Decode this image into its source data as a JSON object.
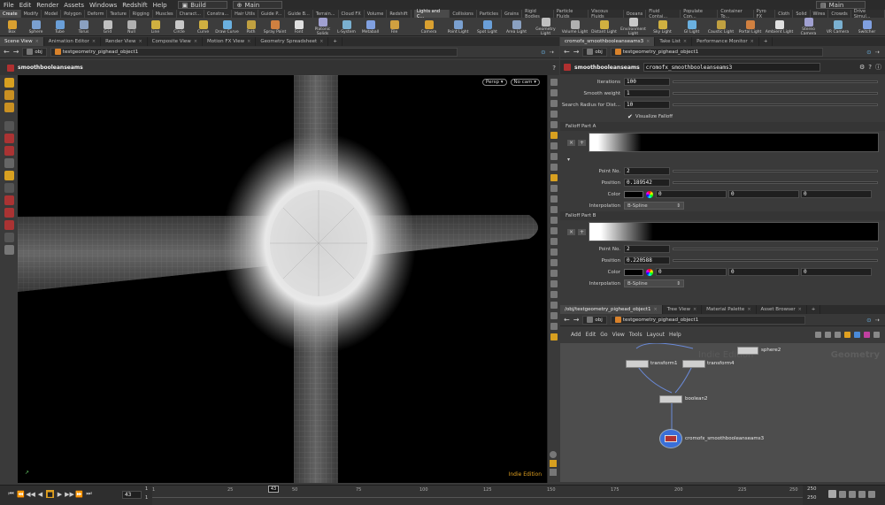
{
  "menubar": {
    "items": [
      "File",
      "Edit",
      "Render",
      "Assets",
      "Windows",
      "Redshift",
      "Help"
    ],
    "desktop": "Build",
    "scene": "Main",
    "right_context": "Main"
  },
  "shelf": {
    "tabs_left": [
      "Create",
      "Modify",
      "Model",
      "Polygon",
      "Deform",
      "Texture",
      "Rigging",
      "Muscles",
      "Charact...",
      "Constra...",
      "Hair Utils",
      "Guide P...",
      "Guide B...",
      "Terrain...",
      "Cloud FX",
      "Volume",
      "Redshift"
    ],
    "tabs_right": [
      "Lights and C...",
      "Collisions",
      "Particles",
      "Grains",
      "Rigid Bodies",
      "Particle Fluids",
      "Viscous Fluids",
      "Oceans",
      "Fluid Contai...",
      "Populate Con...",
      "Container To...",
      "Pyro FX",
      "Cloth",
      "Solid",
      "Wires",
      "Crowds",
      "Drive Simul..."
    ],
    "tools_left": [
      "Box",
      "Sphere",
      "Tube",
      "Torus",
      "Grid",
      "Null",
      "Line",
      "Circle",
      "Curve",
      "Draw Curve",
      "Path",
      "Spray Paint",
      "Font",
      "Platonic Solids",
      "L-System",
      "Metaball",
      "File"
    ],
    "tools_right": [
      "Camera",
      "Point Light",
      "Spot Light",
      "Area Light",
      "Geometry Light",
      "Volume Light",
      "Distant Light",
      "Environment Light",
      "Sky Light",
      "GI Light",
      "Caustic Light",
      "Portal Light",
      "Ambient Light",
      "Stereo Camera",
      "VR Camera",
      "Switcher"
    ]
  },
  "left_pane": {
    "tabs": [
      "Scene View",
      "Animation Editor",
      "Render View",
      "Composite View",
      "Motion FX View",
      "Geometry Spreadsheet"
    ],
    "path_root": "obj",
    "path_node": "testgeometry_pighead_object1",
    "viewport_title": "smoothbooleanseams",
    "persp_label": "Persp",
    "cam_label": "No cam",
    "watermark": "Indie Edition"
  },
  "param_pane": {
    "tabs": [
      "cromofx_smoothbooleanseams3",
      "Take List",
      "Performance Monitor"
    ],
    "path_root": "obj",
    "path_node": "testgeometry_pighead_object1",
    "node_type": "smoothbooleanseams",
    "node_name": "cromofx_smoothbooleanseams3",
    "iterations_label": "Iterations",
    "iterations": "100",
    "smooth_weight_label": "Smooth weight",
    "smooth_weight": "1",
    "search_radius_label": "Search Radius for Dist...",
    "search_radius": "10",
    "visualize_falloff": "Visualize Falloff",
    "falloff_a": {
      "title": "Falloff Part A",
      "point_no_label": "Point No.",
      "point_no": "2",
      "position_label": "Position",
      "position": "0.189542",
      "color_label": "Color",
      "color_values": [
        "0",
        "0",
        "0"
      ],
      "interp_label": "Interpolation",
      "interp": "B-Spline"
    },
    "falloff_b": {
      "title": "Falloff Part B",
      "point_no_label": "Point No.",
      "point_no": "2",
      "position_label": "Position",
      "position": "0.220588",
      "color_label": "Color",
      "color_values": [
        "0",
        "0",
        "0"
      ],
      "interp_label": "Interpolation",
      "interp": "B-Spline"
    }
  },
  "network_pane": {
    "tabs": [
      "/obj/testgeometry_pighead_object1",
      "Tree View",
      "Material Palette",
      "Asset Browser"
    ],
    "path_root": "obj",
    "path_node": "testgeometry_pighead_object1",
    "menu": [
      "Add",
      "Edit",
      "Go",
      "View",
      "Tools",
      "Layout",
      "Help"
    ],
    "context_label": "Geometry",
    "watermark": "Indie Edition",
    "nodes": {
      "transform1": "transform1",
      "transform4": "transform4",
      "sphere2": "sphere2",
      "boolean2": "boolean2",
      "smooth": "cromofx_smoothbooleanseams3"
    }
  },
  "timeline": {
    "current_frame": "43",
    "start": "1",
    "start2": "1",
    "end": "250",
    "end2": "250",
    "ticks": [
      "1",
      "25",
      "43",
      "50",
      "75",
      "100",
      "125",
      "150",
      "175",
      "200",
      "225",
      "250"
    ]
  },
  "colors": {
    "accent_orange": "#e0a020",
    "node_selected": "#3a6fd8"
  }
}
